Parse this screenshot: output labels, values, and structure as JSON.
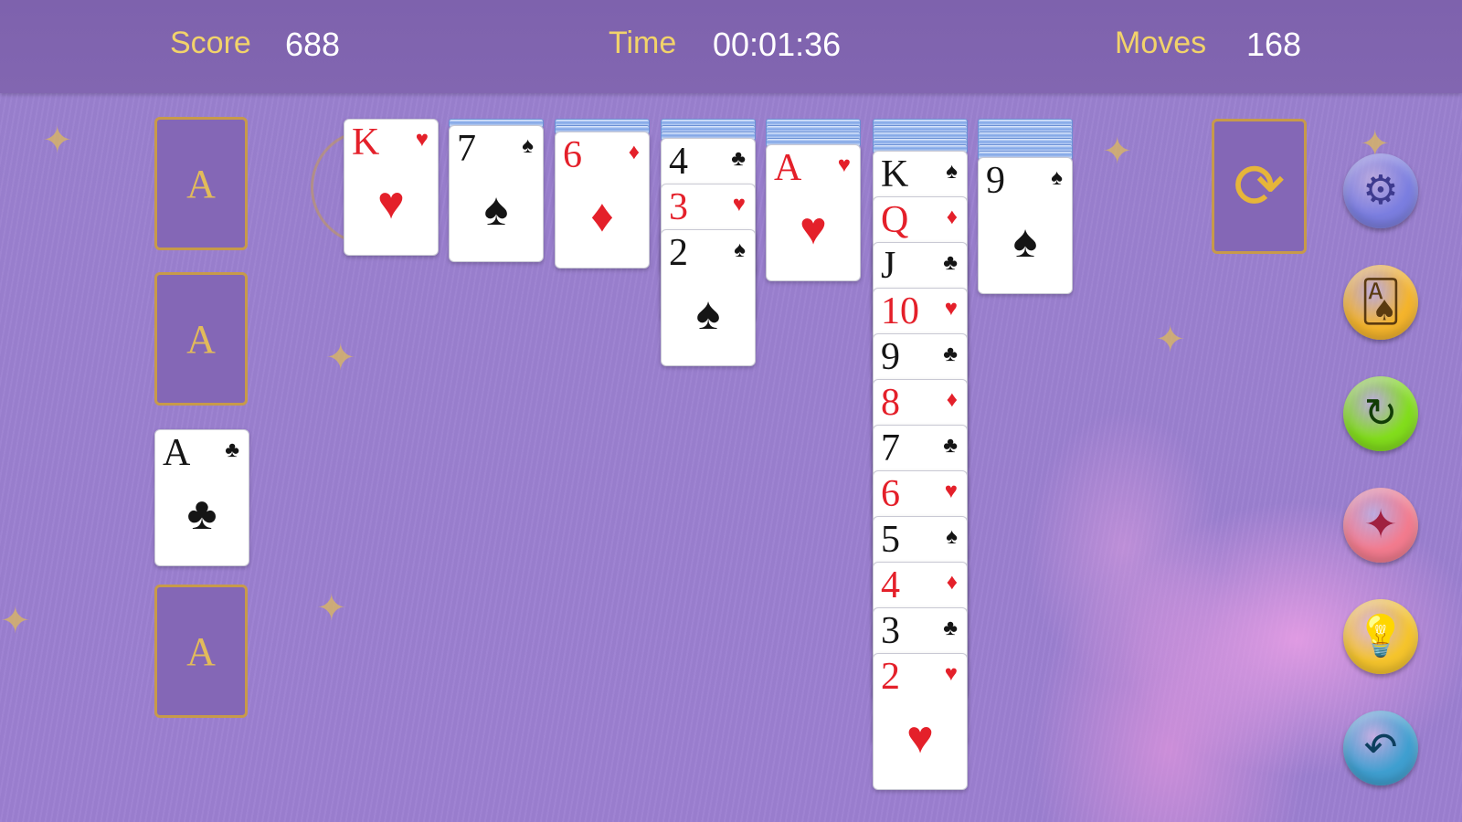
{
  "hud": {
    "score_label": "Score",
    "score_value": "688",
    "time_label": "Time",
    "time_value": "00:01:36",
    "moves_label": "Moves",
    "moves_value": "168"
  },
  "foundations": [
    {
      "type": "empty",
      "letter": "A"
    },
    {
      "type": "empty",
      "letter": "A"
    },
    {
      "type": "card",
      "rank": "A",
      "suit": "♣",
      "color": "black"
    },
    {
      "type": "empty",
      "letter": "A"
    }
  ],
  "tableau": [
    {
      "facedown": 0,
      "cards": [
        {
          "rank": "K",
          "suit": "♥",
          "color": "red"
        }
      ]
    },
    {
      "facedown": 1,
      "cards": [
        {
          "rank": "7",
          "suit": "♠",
          "color": "black"
        }
      ]
    },
    {
      "facedown": 2,
      "cards": [
        {
          "rank": "6",
          "suit": "♦",
          "color": "red"
        }
      ]
    },
    {
      "facedown": 3,
      "cards": [
        {
          "rank": "4",
          "suit": "♣",
          "color": "black"
        },
        {
          "rank": "3",
          "suit": "♥",
          "color": "red"
        },
        {
          "rank": "2",
          "suit": "♠",
          "color": "black"
        }
      ]
    },
    {
      "facedown": 4,
      "cards": [
        {
          "rank": "A",
          "suit": "♥",
          "color": "red"
        }
      ]
    },
    {
      "facedown": 5,
      "cards": [
        {
          "rank": "K",
          "suit": "♠",
          "color": "black"
        },
        {
          "rank": "Q",
          "suit": "♦",
          "color": "red"
        },
        {
          "rank": "J",
          "suit": "♣",
          "color": "black"
        },
        {
          "rank": "10",
          "suit": "♥",
          "color": "red"
        },
        {
          "rank": "9",
          "suit": "♣",
          "color": "black"
        },
        {
          "rank": "8",
          "suit": "♦",
          "color": "red"
        },
        {
          "rank": "7",
          "suit": "♣",
          "color": "black"
        },
        {
          "rank": "6",
          "suit": "♥",
          "color": "red"
        },
        {
          "rank": "5",
          "suit": "♠",
          "color": "black"
        },
        {
          "rank": "4",
          "suit": "♦",
          "color": "red"
        },
        {
          "rank": "3",
          "suit": "♣",
          "color": "black"
        },
        {
          "rank": "2",
          "suit": "♥",
          "color": "red"
        }
      ]
    },
    {
      "facedown": 6,
      "cards": [
        {
          "rank": "9",
          "suit": "♠",
          "color": "black"
        }
      ]
    }
  ],
  "stock": {
    "icon": "recycle-icon",
    "glyph": "⟳"
  },
  "side_buttons": [
    {
      "name": "settings-button",
      "icon": "gear-icon",
      "glyph": "⚙",
      "bg": "#7b7ee0",
      "fg": "#3d3a8e"
    },
    {
      "name": "card-theme-button",
      "icon": "cards-icon",
      "glyph": "🂡",
      "bg": "#f4b42c",
      "fg": "#5a3a10"
    },
    {
      "name": "new-game-button",
      "icon": "refresh-icon",
      "glyph": "↻",
      "bg": "#82dd1c",
      "fg": "#123d06"
    },
    {
      "name": "magic-wand-button",
      "icon": "magic-wand-icon",
      "glyph": "✦",
      "bg": "#f27b8e",
      "fg": "#a02040"
    },
    {
      "name": "hint-button",
      "icon": "lightbulb-icon",
      "glyph": "💡",
      "bg": "#f5c42c",
      "fg": "#8a5a00"
    },
    {
      "name": "undo-button",
      "icon": "undo-icon",
      "glyph": "↶",
      "bg": "#3f9fd0",
      "fg": "#0d3f5e"
    }
  ]
}
